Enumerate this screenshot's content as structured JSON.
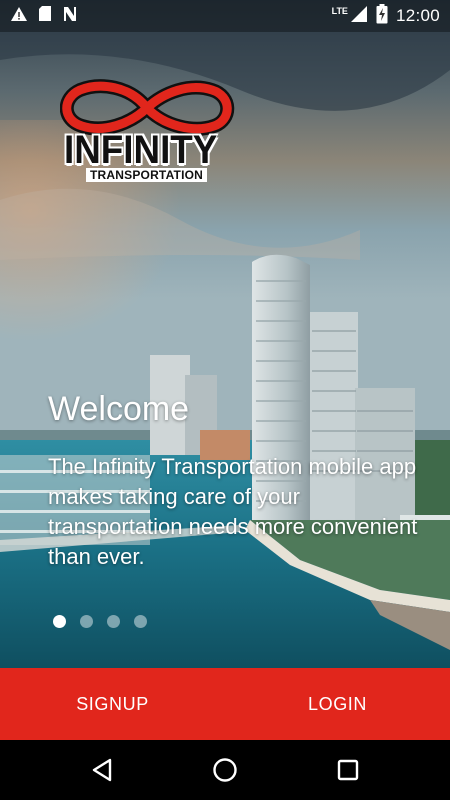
{
  "status_bar": {
    "time": "12:00",
    "network": "LTE",
    "icons": [
      "warning-icon",
      "sd-card-icon",
      "n-icon",
      "signal-icon",
      "battery-charging-icon"
    ]
  },
  "logo": {
    "word": "INFINITY",
    "sub": "TRANSPORTATION",
    "accent_color": "#e1261c"
  },
  "onboarding": {
    "title": "Welcome",
    "body": "The Infinity Transportation mobile app makes taking care of your transportation needs more convenient than ever.",
    "page_count": 4,
    "active_page": 1
  },
  "actions": {
    "signup_label": "SIGNUP",
    "login_label": "LOGIN",
    "bar_color": "#e1261c"
  },
  "nav": {
    "icons": [
      "back-icon",
      "home-icon",
      "recents-icon"
    ]
  }
}
